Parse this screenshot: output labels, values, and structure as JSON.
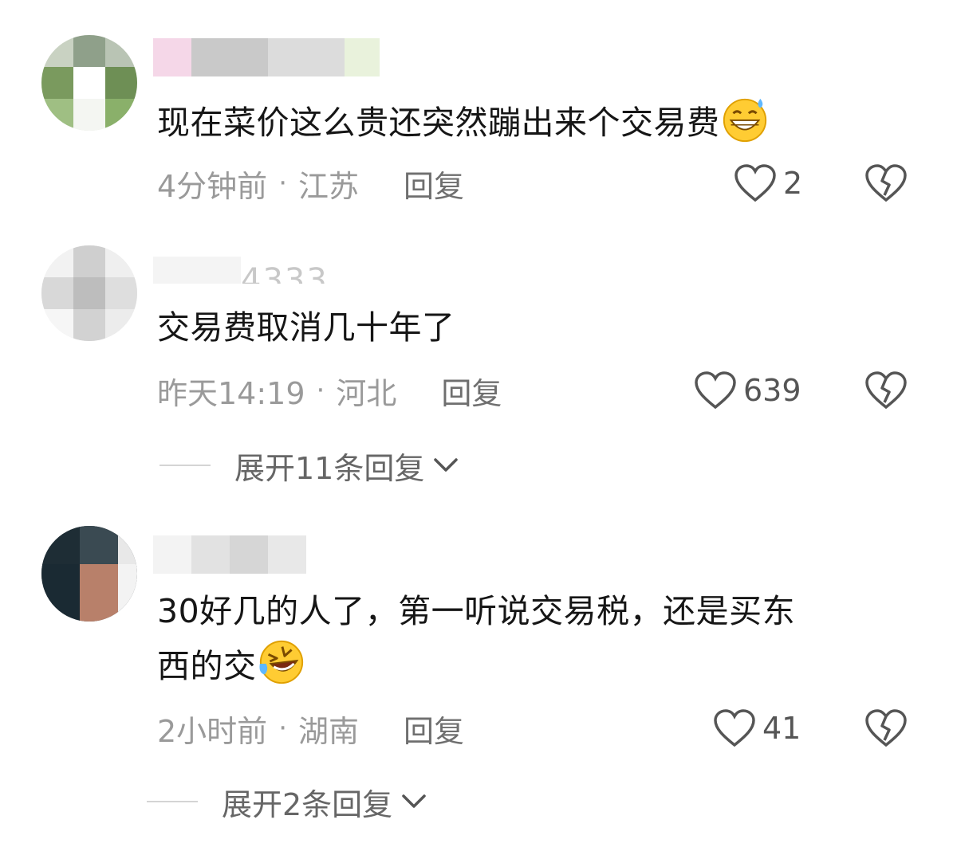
{
  "comments": [
    {
      "text": "现在菜价这么贵还突然蹦出来个交易费",
      "emoji": "grinning-sweat-emoji",
      "time": "4分钟前",
      "location": "江苏",
      "reply_label": "回复",
      "likes": "2"
    },
    {
      "username_partial": "4333",
      "text": "交易费取消几十年了",
      "time": "昨天14:19",
      "location": "河北",
      "reply_label": "回复",
      "likes": "639",
      "expand_label": "展开11条回复"
    },
    {
      "text_line1": "30好几的人了，第一听说交易税，还是买东",
      "text_line2": "西的交",
      "emoji": "rolling-laughing-emoji",
      "time": "2小时前",
      "location": "湖南",
      "reply_label": "回复",
      "likes": "41",
      "expand_label": "展开2条回复"
    }
  ],
  "separator": "·",
  "colors": {
    "text": "#161616",
    "meta": "#9a9a9a",
    "icon": "#555555"
  }
}
